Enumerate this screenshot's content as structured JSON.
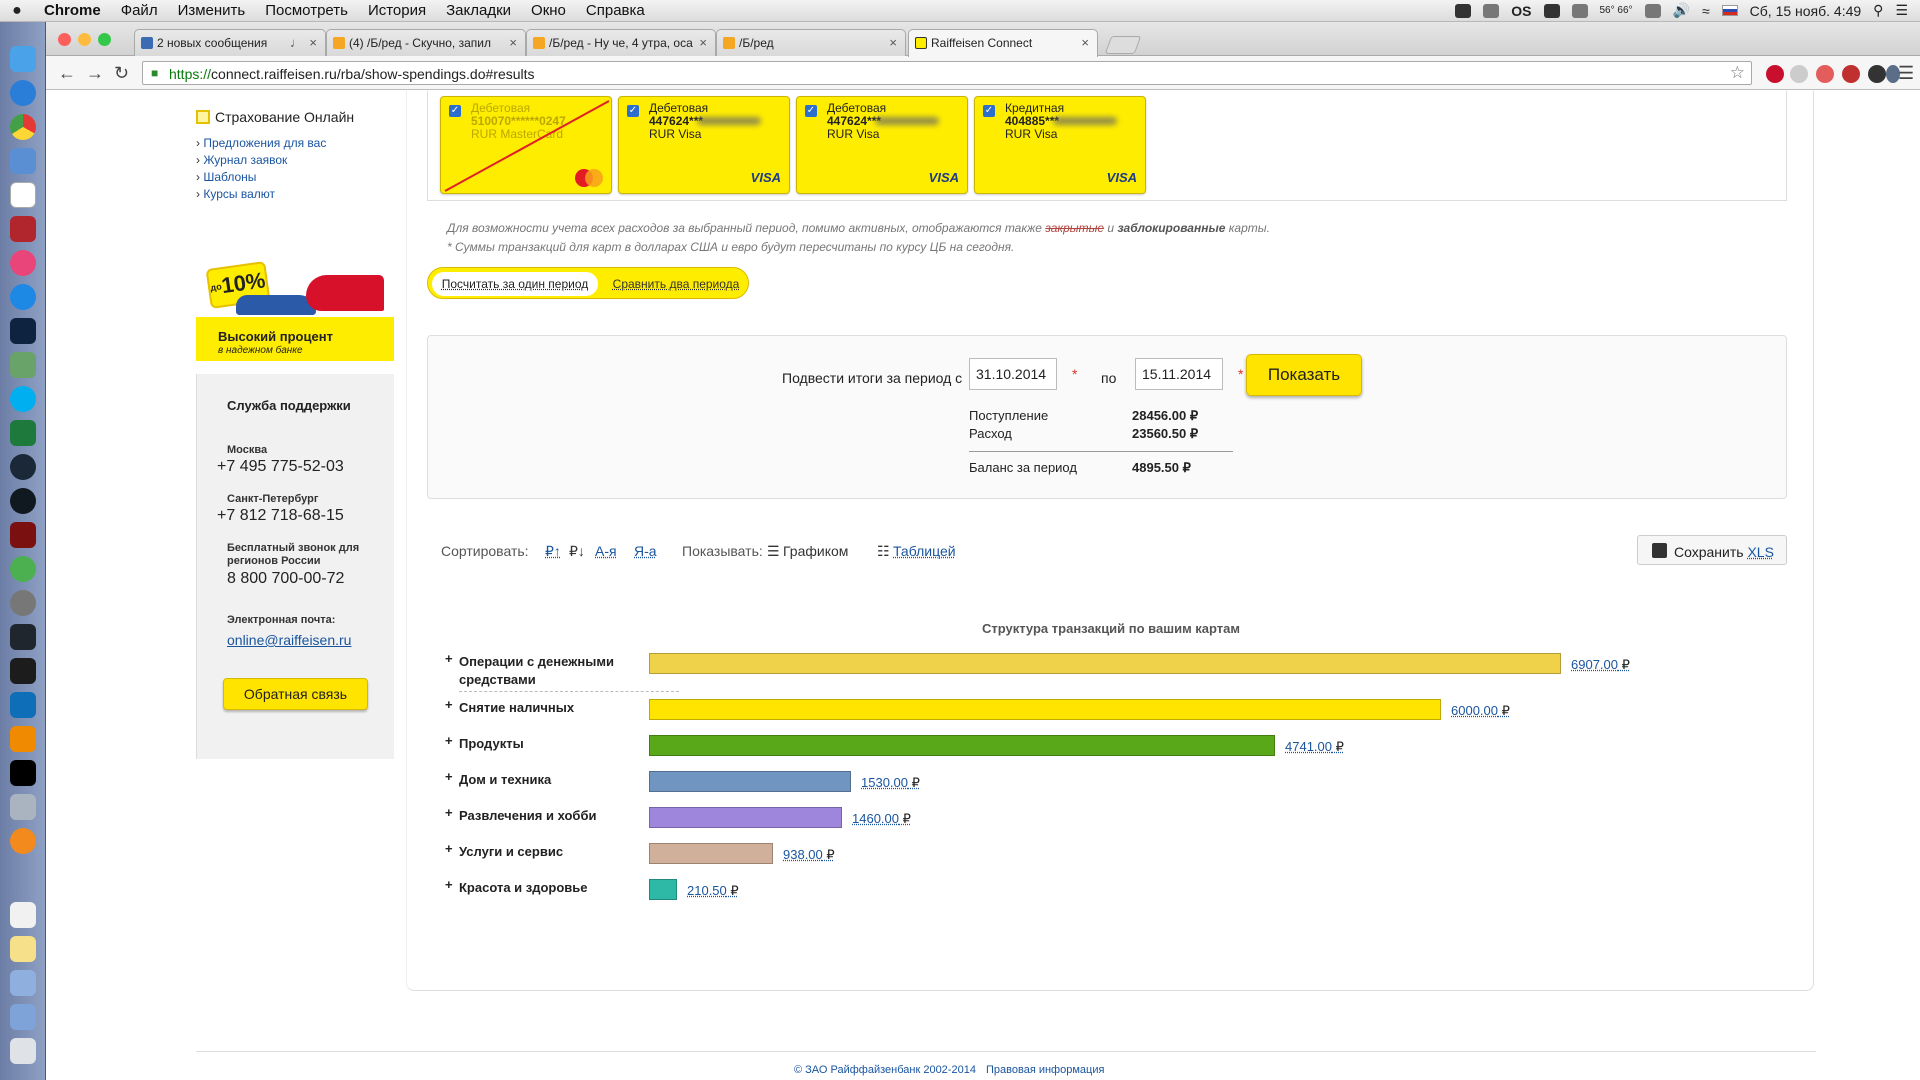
{
  "menubar": {
    "apple": "",
    "items": [
      "Chrome",
      "Файл",
      "Изменить",
      "Посмотреть",
      "История",
      "Закладки",
      "Окно",
      "Справка"
    ],
    "tray_text": "OS",
    "temp": "56° 66°",
    "clock": "Сб, 15 нояб.  4:49"
  },
  "browser": {
    "tabs": [
      {
        "title": "2 новых сообщения",
        "color": "#3b6bb0"
      },
      {
        "title": "(4) /Б/ред - Скучно, запил",
        "color": "#f5a623"
      },
      {
        "title": "/Б/ред - Ну че, 4 утра, оса",
        "color": "#f5a623"
      },
      {
        "title": "/Б/ред",
        "color": "#f5a623"
      },
      {
        "title": "Raiffeisen Connect",
        "color": "#ffed00"
      }
    ],
    "url_scheme": "https://",
    "url_rest": "connect.raiffeisen.ru/rba/show-spendings.do#results"
  },
  "sidebar": {
    "insurance_title": "Страхование Онлайн",
    "links": [
      "Предложения для вас",
      "Журнал заявок",
      "Шаблоны",
      "Курсы валют"
    ],
    "promo": {
      "badge": "10%",
      "badge_prefix": "до",
      "title": "Высокий процент",
      "subtitle": "в надежном банке"
    },
    "support": {
      "title": "Служба поддержки",
      "moscow_label": "Москва",
      "moscow_phone": "+7 495 775-52-03",
      "spb_label": "Санкт-Петербург",
      "spb_phone": "+7 812 718-68-15",
      "free_label_1": "Бесплатный звонок для",
      "free_label_2": "регионов России",
      "free_phone": "8 800 700-00-72",
      "email_label": "Электронная почта:",
      "email": "online@raiffeisen.ru",
      "feedback_button": "Обратная связь"
    }
  },
  "cards": [
    {
      "type": "Дебетовая",
      "number": "510070******0247",
      "currency": "RUR  MasterCard",
      "brand": "mastercard",
      "enabled": false
    },
    {
      "type": "Дебетовая",
      "number": "447624***",
      "currency": "RUR  Visa",
      "brand": "VISA",
      "enabled": true
    },
    {
      "type": "Дебетовая",
      "number": "447624***",
      "currency": "RUR  Visa",
      "brand": "VISA",
      "enabled": true
    },
    {
      "type": "Кредитная",
      "number": "404885***",
      "currency": "RUR  Visa",
      "brand": "VISA",
      "enabled": true
    }
  ],
  "note": {
    "line1_a": "Для возможности учета всех расходов за выбранный период, помимо активных, отображаются также ",
    "line1_closed": "закрытые",
    "line1_and": " и ",
    "line1_blocked": "заблокированные",
    "line1_end": " карты.",
    "line2": "* Суммы транзакций для карт в долларах США и евро будут пересчитаны по курсу ЦБ на сегодня."
  },
  "period_switch": {
    "one": "Посчитать за один период",
    "two": "Сравнить два периода"
  },
  "summary": {
    "period_label": "Подвести итоги за период с",
    "date_from": "31.10.2014",
    "po": "по",
    "date_to": "15.11.2014",
    "show_button": "Показать",
    "income_label": "Поступление",
    "income": "28456.00 ₽",
    "expense_label": "Расход",
    "expense": "23560.50 ₽",
    "balance_label": "Баланс за период",
    "balance": "4895.50 ₽"
  },
  "sortbar": {
    "sort_label": "Сортировать:",
    "sort_asc": "₽↑",
    "sort_desc": "₽↓",
    "sort_az": "А-я",
    "sort_za": "Я-а",
    "show_label": "Показывать:",
    "view_chart": "Графиком",
    "view_table": "Таблицей",
    "save": "Сохранить",
    "xls": "XLS"
  },
  "chart_title": "Структура транзакций по вашим картам",
  "chart_data": {
    "type": "bar",
    "orientation": "horizontal",
    "title": "Структура транзакций по вашим картам",
    "currency": "₽",
    "categories": [
      "Операции с денежными средствами",
      "Снятие наличных",
      "Продукты",
      "Дом и техника",
      "Развлечения и хобби",
      "Услуги и сервис",
      "Красота и здоровье"
    ],
    "values": [
      6907.0,
      6000.0,
      4741.0,
      1530.0,
      1460.0,
      938.0,
      210.5
    ],
    "labels": [
      "6907.00",
      "6000.00",
      "4741.00",
      "1530.00",
      "1460.00",
      "938.00",
      "210.50"
    ],
    "colors": [
      "#f0d24a",
      "#ffe400",
      "#58a819",
      "#6f95c0",
      "#9d86dc",
      "#d0b09a",
      "#2eb8a6"
    ]
  },
  "footer": {
    "copyright": "© ЗАО Райффайзенбанк 2002-2014",
    "legal": "Правовая информация"
  }
}
